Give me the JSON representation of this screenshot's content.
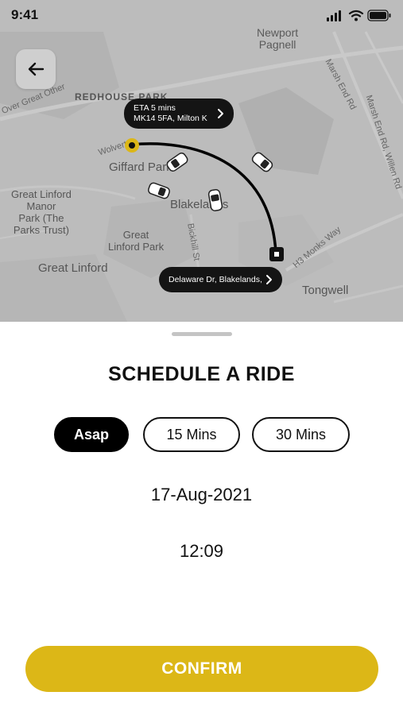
{
  "status_bar": {
    "time": "9:41"
  },
  "map": {
    "labels": {
      "newport": "Newport\nPagnell",
      "marsh_end_rd": "Marsh End Rd",
      "marsh_end_rd_2": "Marsh End Rd, Willen Rd",
      "over_great": "Over Great Other",
      "redhouse_park": "REDHOUSE PARK",
      "wolverton": "Wolverton",
      "giffard_park": "Giffard Park",
      "great_linford_manor": "Great Linford\nManor\nPark (The\nParks Trust)",
      "blakelands": "Blakelands",
      "great_linford_park": "Great\nLinford Park",
      "bickhill_st": "Bickhill St",
      "great_linford": "Great Linford",
      "h3_monks_way": "H3 Monks Way",
      "tongwell": "Tongwell"
    },
    "pickup": {
      "line1": "ETA 5 mins",
      "line2": "MK14 5FA, Milton K"
    },
    "dropoff": {
      "line1": "Delaware Dr, Blakelands,"
    },
    "route_color": "#000000",
    "pickup_color": "#dcb717"
  },
  "sheet": {
    "title": "SCHEDULE A RIDE",
    "options": [
      {
        "label": "Asap",
        "active": true
      },
      {
        "label": "15 Mins",
        "active": false
      },
      {
        "label": "30 Mins",
        "active": false
      }
    ],
    "date": "17-Aug-2021",
    "time": "12:09",
    "confirm_label": "CONFIRM",
    "accent": "#dcb717"
  }
}
